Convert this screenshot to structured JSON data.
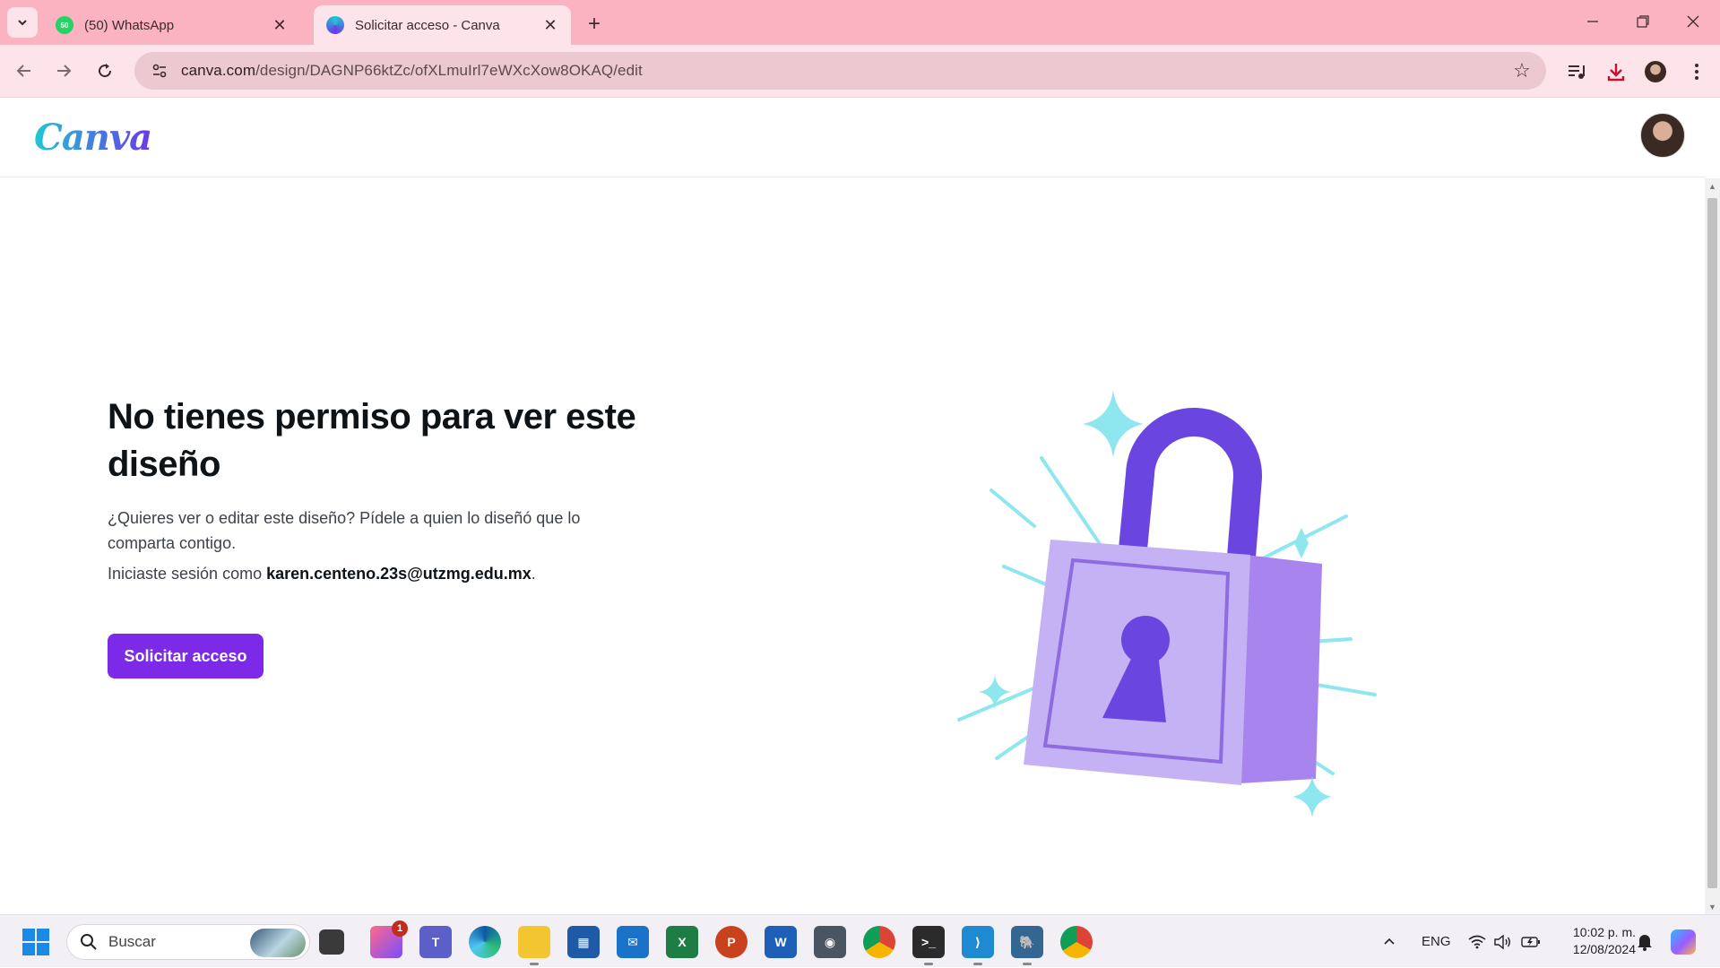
{
  "browser": {
    "tabs": [
      {
        "title": "(50) WhatsApp",
        "favicon_badge": "50",
        "active": false
      },
      {
        "title": "Solicitar acceso - Canva",
        "active": true
      }
    ],
    "url_domain": "canva.com",
    "url_path": "/design/DAGNP66ktZc/ofXLmuIrl7eWXcXow8OKAQ/edit"
  },
  "canva": {
    "logo_text": "Canva",
    "heading": "No tienes permiso para ver este diseño",
    "description": "¿Quieres ver o editar este diseño? Pídele a quien lo diseñó que lo comparta contigo.",
    "signed_in_prefix": "Iniciaste sesión como",
    "signed_in_email": "karen.centeno.23s@utzmg.edu.mx",
    "signed_in_suffix": ".",
    "request_button": "Solicitar acceso"
  },
  "taskbar": {
    "search_label": "Buscar",
    "notification_count": "1",
    "language": "ENG",
    "time": "10:02 p. m.",
    "date": "12/08/2024"
  },
  "colors": {
    "tab_bar": "#fbb3c1",
    "toolbar": "#fde4ea",
    "canva_purple": "#7d2ae8",
    "lock_body": "#c4b2f5",
    "lock_shackle": "#6a45e0",
    "sparkle": "#8ee6ee"
  }
}
